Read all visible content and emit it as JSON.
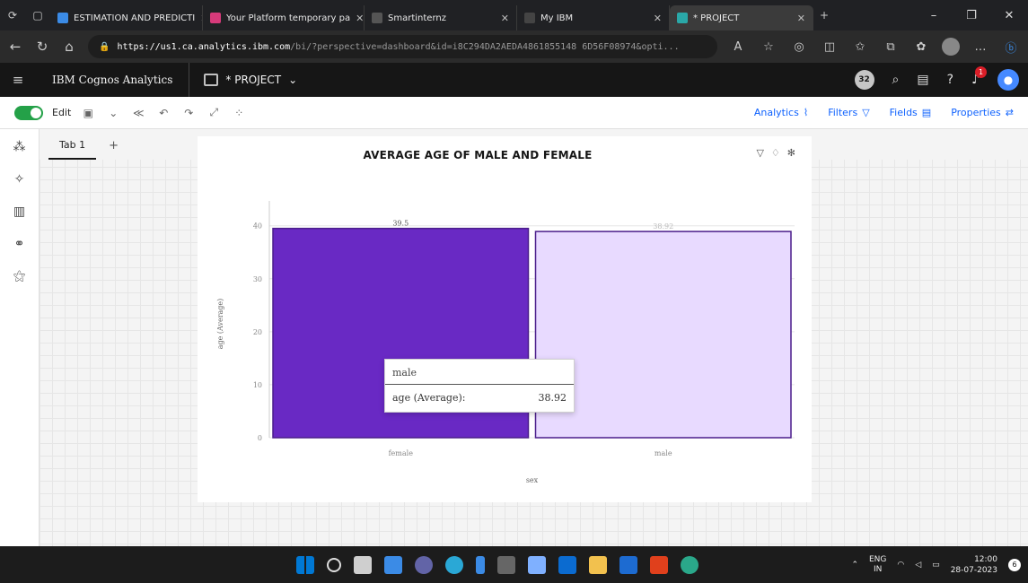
{
  "browser": {
    "tabs": [
      {
        "label": "ESTIMATION AND PREDICTI",
        "color": "#3b8be6"
      },
      {
        "label": "Your Platform temporary pa",
        "color": "#d63a7a"
      },
      {
        "label": "Smartinternz",
        "color": "#555555"
      },
      {
        "label": "My IBM",
        "color": "#444444"
      },
      {
        "label": "* PROJECT",
        "color": "#2aa8a8"
      }
    ],
    "url_host": "https://us1.ca.analytics.ibm.com",
    "url_path": "/bi/?perspective=dashboard&id=i8C294DA2AEDA4861855148 6D56F08974&opti..."
  },
  "cognos": {
    "brand": "IBM Cognos Analytics",
    "project": "* PROJECT",
    "badge_count": "32",
    "notif_count": "1"
  },
  "toolbar": {
    "edit_label": "Edit",
    "analytics": "Analytics",
    "filters": "Filters",
    "fields": "Fields",
    "properties": "Properties"
  },
  "dashboard": {
    "tab_label": "Tab 1",
    "add_tab": "+"
  },
  "chart_data": {
    "type": "bar",
    "title": "AVERAGE AGE OF MALE AND FEMALE",
    "xlabel": "sex",
    "ylabel": "age (Average)",
    "categories": [
      "female",
      "male"
    ],
    "values": [
      39.5,
      38.92
    ],
    "data_labels": [
      "39.5",
      "38.92"
    ],
    "colors": [
      "#6929c4",
      "#e8daff"
    ],
    "bar_stroke": "#4a1d8a",
    "ylim": [
      0,
      43
    ],
    "yticks": [
      0,
      10,
      20,
      30,
      40
    ],
    "grid": true
  },
  "tooltip": {
    "category": "male",
    "measure_label": "age (Average):",
    "measure_value": "38.92"
  },
  "taskbar": {
    "lang": "ENG",
    "region": "IN",
    "time": "12:00",
    "date": "28-07-2023",
    "notif": "6"
  }
}
